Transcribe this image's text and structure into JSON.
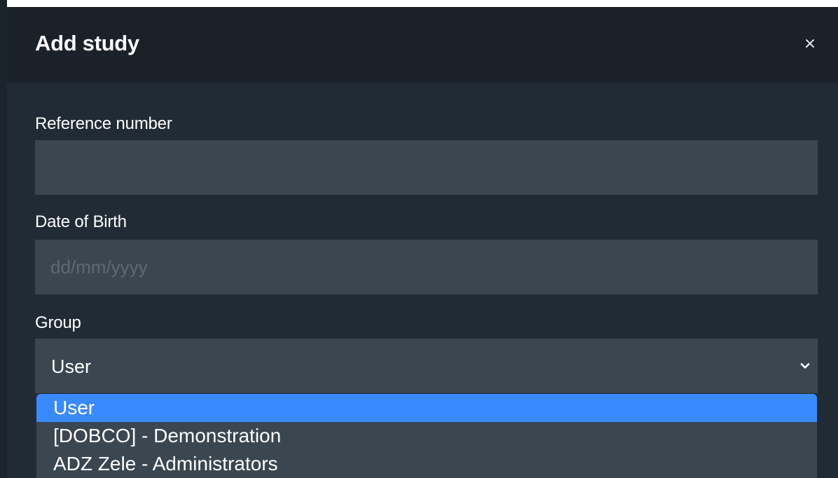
{
  "dialog": {
    "title": "Add study",
    "close_label": "×"
  },
  "fields": {
    "reference_number": {
      "label": "Reference number",
      "value": "",
      "placeholder": ""
    },
    "date_of_birth": {
      "label": "Date of Birth",
      "value": "",
      "placeholder": "dd/mm/yyyy"
    },
    "group": {
      "label": "Group",
      "selected": "User",
      "options": [
        "User",
        "[DOBCO] - Demonstration",
        "ADZ Zele - Administrators"
      ]
    }
  },
  "icons": {
    "close": "close-icon",
    "chevron": "chevron-down-icon"
  },
  "colors": {
    "header_bg": "#1a2129",
    "body_bg": "#212b35",
    "input_bg": "#3a4650",
    "selected_option": "#3a8aff"
  }
}
